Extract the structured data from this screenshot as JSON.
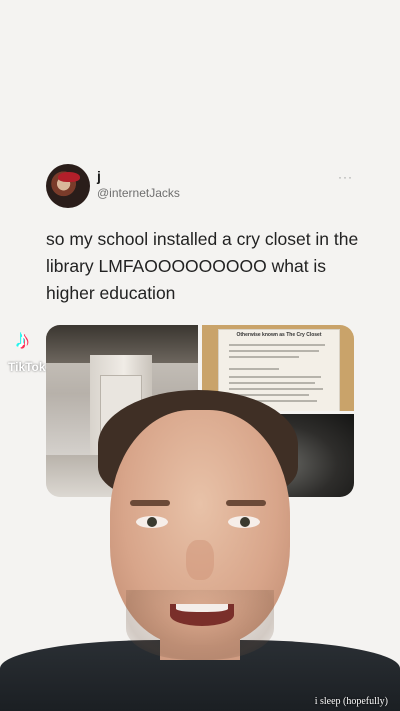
{
  "tweet": {
    "display_name": "j",
    "handle": "@internetJacks",
    "more_icon": "ellipsis-icon",
    "text": "so my school installed a cry closet in the library LMFAOOOOOOOOO what is higher education"
  },
  "media": {
    "sign_title": "Otherwise known as The Cry Closet"
  },
  "watermark": {
    "app": "TikTok",
    "icon": "tiktok-logo-icon"
  },
  "video": {
    "caption": "i sleep (hopefully)"
  }
}
